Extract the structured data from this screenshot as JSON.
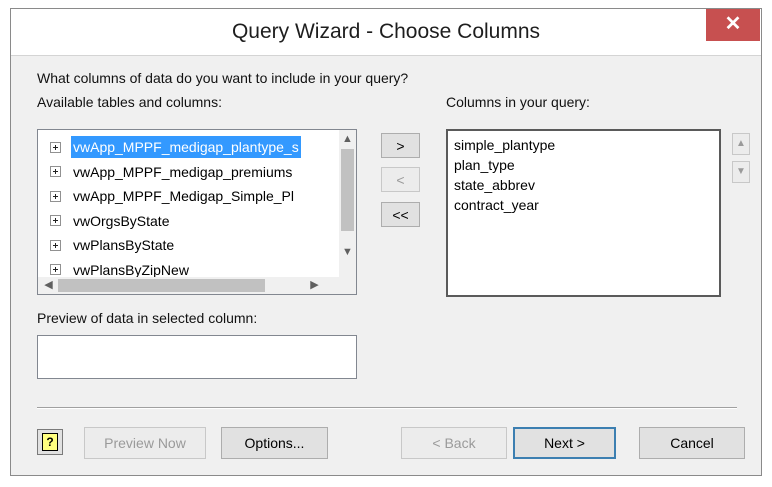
{
  "window": {
    "title": "Query Wizard - Choose Columns",
    "close_glyph": "✕"
  },
  "prompt": "What columns of data do you want to include in your query?",
  "available": {
    "label": "Available tables and columns:",
    "items": [
      {
        "text": "vwApp_MPPF_medigap_plantype_s",
        "selected": true
      },
      {
        "text": "vwApp_MPPF_medigap_premiums",
        "selected": false
      },
      {
        "text": "vwApp_MPPF_Medigap_Simple_Pl",
        "selected": false
      },
      {
        "text": "vwOrgsByState",
        "selected": false
      },
      {
        "text": "vwPlansByState",
        "selected": false
      },
      {
        "text": "vwPlansByZipNew",
        "selected": false
      }
    ]
  },
  "move_buttons": {
    "add": ">",
    "remove": "<",
    "remove_all": "<<"
  },
  "query_columns": {
    "label": "Columns in your query:",
    "items": [
      "simple_plantype",
      "plan_type",
      "state_abbrev",
      "contract_year"
    ]
  },
  "preview": {
    "label": "Preview of data in selected column:",
    "value": ""
  },
  "footer": {
    "help_glyph": "?",
    "preview_now": "Preview Now",
    "options": "Options...",
    "back": "< Back",
    "next": "Next >",
    "cancel": "Cancel"
  },
  "icons": {
    "scroll_up": "▲",
    "scroll_down": "▼",
    "scroll_left": "◀",
    "scroll_right": "▶"
  }
}
